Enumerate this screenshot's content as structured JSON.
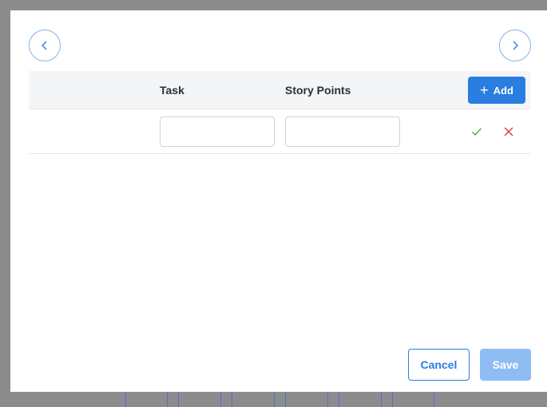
{
  "navigation": {
    "prev_icon": "chevron-left-icon",
    "next_icon": "chevron-right-icon"
  },
  "table": {
    "columns": [
      {
        "label": "Task"
      },
      {
        "label": "Story Points"
      }
    ],
    "add_button": {
      "icon": "+",
      "label": "Add"
    },
    "new_row": {
      "task_value": "",
      "story_points_value": "",
      "confirm_icon": "check-icon",
      "discard_icon": "x-icon"
    }
  },
  "footer": {
    "cancel_label": "Cancel",
    "save_label": "Save"
  },
  "colors": {
    "accent": "#2a7de1",
    "save_disabled": "#8fbdf3",
    "confirm": "#4caf50",
    "discard": "#e53935",
    "header_bg": "#f4f5f7"
  }
}
